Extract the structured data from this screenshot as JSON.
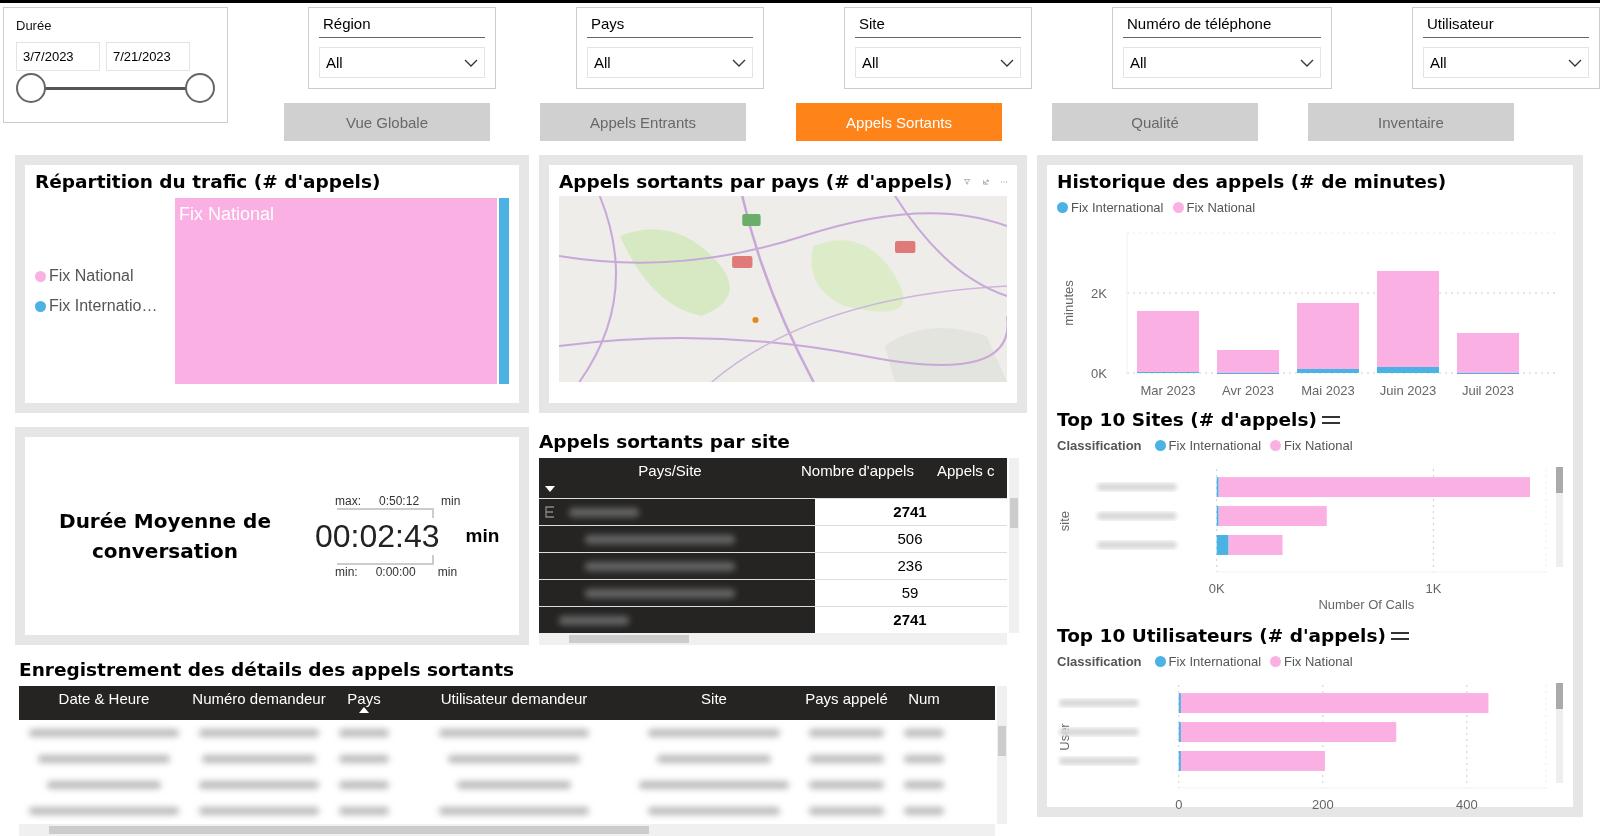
{
  "duration": {
    "label": "Durée",
    "start": "3/7/2023",
    "end": "7/21/2023",
    "thumbs": [
      {
        "level": 0
      },
      {
        "level": 1
      }
    ]
  },
  "dropdowns": [
    {
      "label": "Région",
      "value": "All"
    },
    {
      "label": "Pays",
      "value": "All"
    },
    {
      "label": "Site",
      "value": "All"
    },
    {
      "label": "Numéro de téléphone",
      "value": "All"
    },
    {
      "label": "Utilisateur",
      "value": "All"
    }
  ],
  "nav_buttons": [
    {
      "label": "Vue Globale",
      "selected": false
    },
    {
      "label": "Appels Entrants",
      "selected": false
    },
    {
      "label": "Appels Sortants",
      "selected": true
    },
    {
      "label": "Qualité",
      "selected": false
    },
    {
      "label": "Inventaire",
      "selected": false
    }
  ],
  "traffic": {
    "title": "Répartition du trafic (# d'appels)",
    "tile_label": "Fix National",
    "legend": [
      {
        "label": "Fix National",
        "color": "#fbb0e3"
      },
      {
        "label": "Fix Internatio…",
        "color": "#4bb2e4"
      }
    ]
  },
  "kpi": {
    "title": "Durée Moyenne de conversation",
    "value": "00:02:43",
    "unit": "min",
    "max_label": "max:",
    "max_value": "0:50:12",
    "max_unit": "min",
    "min_label": "min:",
    "min_value": "0:00:00",
    "min_unit": "min"
  },
  "map": {
    "title": "Appels sortants par pays (# d'appels)",
    "kind": "picture"
  },
  "site_table": {
    "title": "Appels sortants par site",
    "columns": [
      "Pays/Site",
      "Nombre d'appels",
      "Appels c"
    ],
    "rows": [
      {
        "kind": "total",
        "value": "2741"
      },
      {
        "kind": "detail",
        "value": "506"
      },
      {
        "kind": "detail",
        "value": "236"
      },
      {
        "kind": "detail",
        "value": "59"
      },
      {
        "kind": "total",
        "value": "2741"
      }
    ]
  },
  "history": {
    "title": "Historique des appels (# de minutes)",
    "chart_data": {
      "type": "bar",
      "stacked": true,
      "ylabel": "minutes",
      "categories": [
        "Mar 2023",
        "Avr 2023",
        "Mai 2023",
        "Juin 2023",
        "Juil 2023"
      ],
      "yticks": [
        {
          "value": 0,
          "label": "0K"
        },
        {
          "value": 2000,
          "label": "2K"
        }
      ],
      "ylim": [
        0,
        3500
      ],
      "series": [
        {
          "name": "Fix International",
          "color": "#4bb2e4",
          "values": [
            20,
            10,
            100,
            150,
            10
          ]
        },
        {
          "name": "Fix National",
          "color": "#fbb0e3",
          "values": [
            1530,
            570,
            1650,
            2400,
            990
          ]
        }
      ]
    }
  },
  "top_sites": {
    "title": "Top 10 Sites (# d'appels)",
    "legend_title": "Classification",
    "chart_data": {
      "type": "bar",
      "orientation": "horizontal",
      "stacked": true,
      "xlabel": "Number Of Calls",
      "ylabel": "site",
      "xticks": [
        {
          "value": 0,
          "label": "0K"
        },
        {
          "value": 1000,
          "label": "1K"
        }
      ],
      "xlim": [
        0,
        1520
      ],
      "series": [
        {
          "name": "Fix International",
          "color": "#4bb2e4",
          "values": [
            3,
            3,
            55
          ]
        },
        {
          "name": "Fix National",
          "color": "#fbb0e3",
          "values": [
            1437,
            499,
            249
          ]
        }
      ]
    }
  },
  "top_users": {
    "title": "Top 10 Utilisateurs (# d'appels)",
    "legend_title": "Classification",
    "chart_data": {
      "type": "bar",
      "orientation": "horizontal",
      "stacked": true,
      "ylabel": "User",
      "xticks": [
        0,
        200,
        400
      ],
      "xlim": [
        0,
        510
      ],
      "series": [
        {
          "name": "Fix International",
          "color": "#4bb2e4",
          "values": [
            3,
            3,
            3
          ]
        },
        {
          "name": "Fix National",
          "color": "#fbb0e3",
          "values": [
            427,
            299,
            200
          ]
        }
      ]
    }
  },
  "details": {
    "title": "Enregistrement des détails des appels sortants",
    "columns": [
      {
        "label": "Date & Heure",
        "sorted": false
      },
      {
        "label": "Numéro demandeur",
        "sorted": false
      },
      {
        "label": "Pays",
        "sorted": true
      },
      {
        "label": "Utilisateur demandeur",
        "sorted": false
      },
      {
        "label": "Site",
        "sorted": false
      },
      {
        "label": "Pays appelé",
        "sorted": false
      },
      {
        "label": "Num",
        "sorted": false
      }
    ]
  }
}
